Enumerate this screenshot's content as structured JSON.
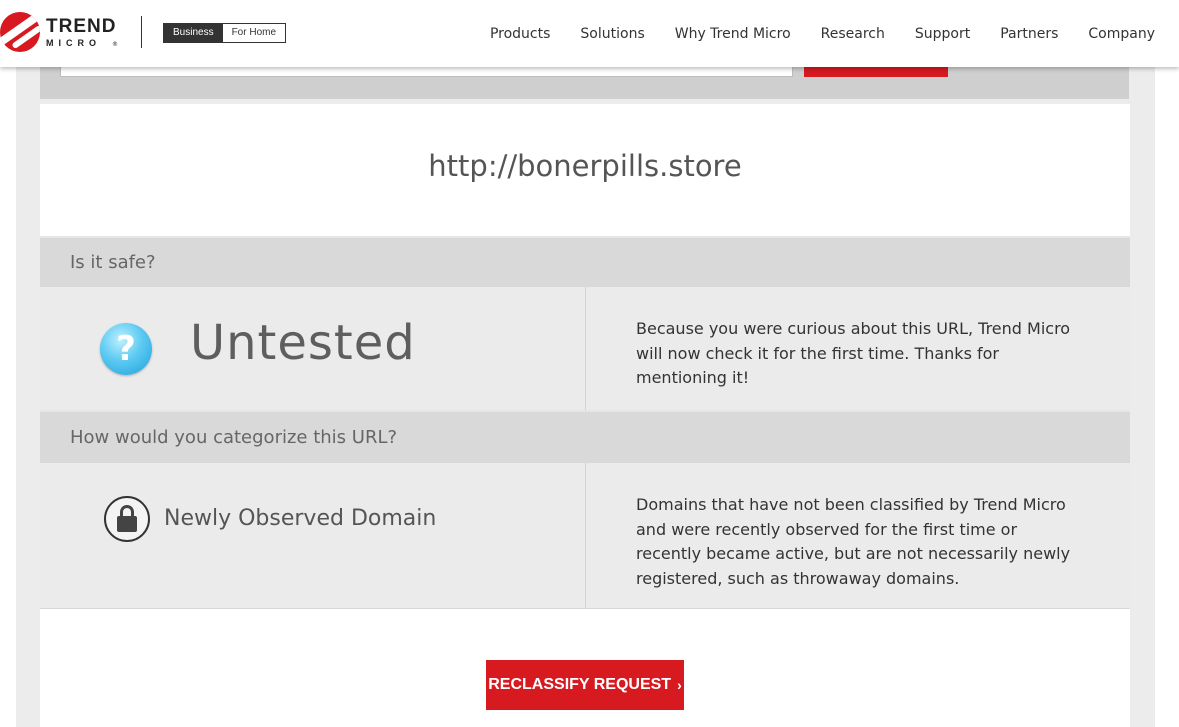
{
  "header": {
    "logo_word1": "TREND",
    "logo_word2": "MICRO",
    "logo_tm": "®",
    "segment": {
      "business_label": "Business",
      "home_label": "For Home"
    },
    "nav": [
      "Products",
      "Solutions",
      "Why Trend Micro",
      "Research",
      "Support",
      "Partners",
      "Company"
    ]
  },
  "result": {
    "url": "http://bonerpills.store",
    "safety_heading": "Is it safe?",
    "safety_icon": "question-icon",
    "safety_status": "Untested",
    "safety_description": "Because you were curious about this URL, Trend Micro will now check it for the first time. Thanks for mentioning it!",
    "category_heading": "How would you categorize this URL?",
    "category_icon": "lock-icon",
    "category_name": "Newly Observed Domain",
    "category_description": "Domains that have not been classified by Trend Micro and were recently observed for the first time or recently became active, but are not necessarily newly registered, such as throwaway domains."
  },
  "actions": {
    "reclassify_label": "RECLASSIFY REQUEST",
    "reclassify_chevron": "›"
  },
  "colors": {
    "brand_red": "#d71920",
    "bar_gray": "#d9d9d9",
    "row_gray": "#ebebeb"
  }
}
